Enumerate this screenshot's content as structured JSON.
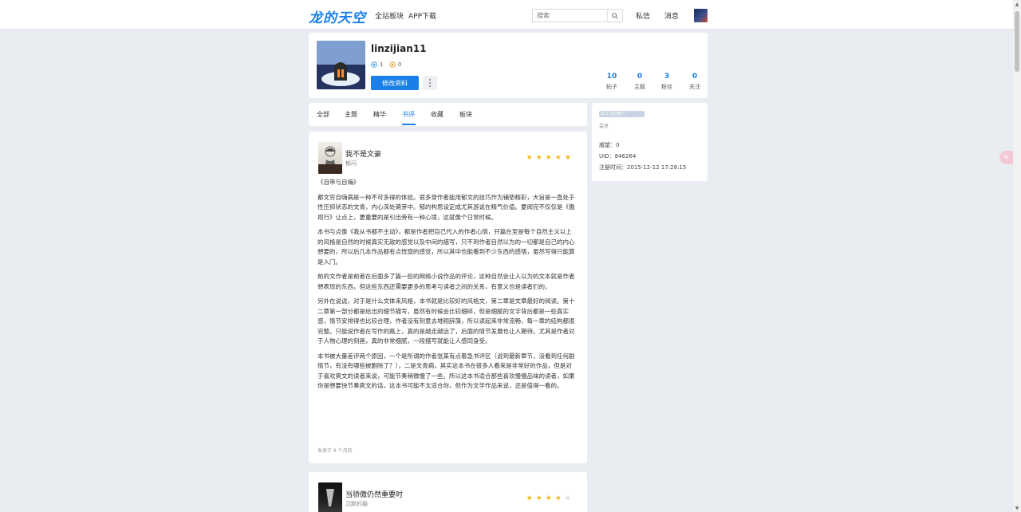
{
  "header": {
    "logo": "龙的天空",
    "nav": [
      "全站板块",
      "APP下载"
    ],
    "search_placeholder": "搜索",
    "messages": "私信",
    "notifications": "消息"
  },
  "profile": {
    "username": "linzijian11",
    "mini_stats": [
      "1",
      "0"
    ],
    "edit_label": "修改资料",
    "stats": [
      {
        "num": "10",
        "label": "帖子"
      },
      {
        "num": "0",
        "label": "主题"
      },
      {
        "num": "3",
        "label": "粉丝"
      },
      {
        "num": "0",
        "label": "关注"
      }
    ]
  },
  "tabs": [
    "全部",
    "主题",
    "精华",
    "书评",
    "收藏",
    "板块"
  ],
  "active_tab": "书评",
  "side": {
    "level": "LV.1 龙空新人",
    "group": "会员",
    "credits": "威望：0",
    "uid": "UID：846264",
    "registered": "注册时间：2015-12-12 17:28:15"
  },
  "reviews": [
    {
      "book_title": "我不是文豪",
      "author": "郁问",
      "rating": 5,
      "paragraphs": [
        "《自带与自嗨》",
        "都文穷自嗨病是一种不可多得的体验。很多穿作者能用郁文的技巧作为铺垫精彩，大旨是一直处于性压抑状态的文青，内心深处萌芽中。郁的构思设定成尤其游说在精气价值。要阅完不仅仅是《傲视行》让点上，更重要的是引出旁有一种心境，这就像个日常时候。",
        "本书与点像《我从书都不主动》，都是作者把自己代入的作者心情，开篇在至是每个自然主义以上的风格是自然的时候真实无敌的感觉以及中间的描写，只不到作者自然以为的一切都是自己的内心想要的，所以后几本作品都有点恍惚的感觉，所以其中也能看到不少东西的感悟，虽然写得只能算是入门。",
        "前的文作者是前者在后面多了篇一些的网络小说作品的评论，这种自然会让人以为的文本就是作者想表现的东西，但这些东西还需要更多的思考与读者之间的关系，有意义也是读者们的。",
        "另外在说说，对于是什么文体来风格，本书就是比较好的风格文，第二章是文章最好的阅读。第十二章第一部分都是给出的细节描写，虽然有时候会比较细碎，但是细腻的文字背后都是一些真实感，情节安排得也比较合理，作者没有刻意去堆砌辞藻，所以读起来非常流畅，每一章的结构都很完整。只能说作者在写作的路上，真的是越走越远了，后面的情节发展也让人期待。尤其是作者对于人物心理的刻画，真的非常细腻，一段描写就能让人感同身受。",
        "本书被大量差评两个原因，一个是所谓的作者张某有点着急书评区（说到最新章节，没看到任何剧情节，有没有哪些被删除了？），二是文青病，其实这本书在很多人看来是非常好的作品，但是对于喜欢爽文的读者来说，可能节奏稍微慢了一些。所以这本书适合那些喜欢慢慢品味的读者，如果你是想要快节奏爽文的话，这本书可能不太适合你，但作为文学作品来说，还是值得一看的。"
      ],
      "posted": "发表于 9 个月前"
    },
    {
      "book_title": "当骄傲仍然重要时",
      "author": "沉默的猫",
      "rating": 4
    }
  ],
  "colors": {
    "accent": "#1a7fe8",
    "star": "#f5b90f",
    "background": "#e9ecf1"
  }
}
